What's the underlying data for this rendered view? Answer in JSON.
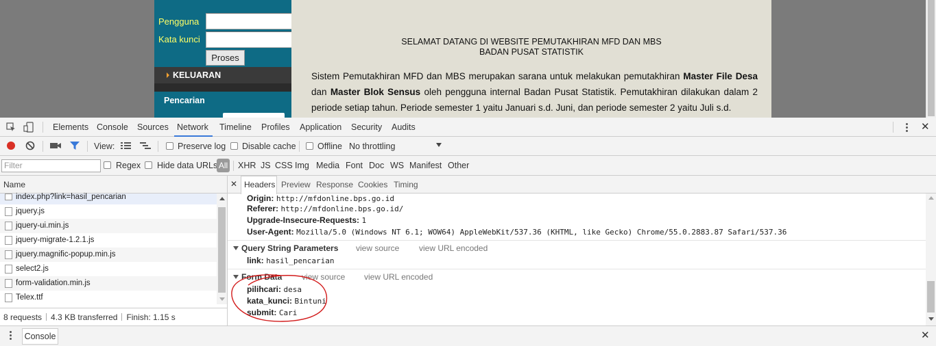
{
  "webpage": {
    "login": {
      "user_label": "Pengguna",
      "password_label": "Kata kunci",
      "submit_label": "Proses"
    },
    "menu": {
      "keluaran": "KELUARAN",
      "pencarian": "Pencarian"
    },
    "welcome": {
      "line1": "SELAMAT DATANG DI WEBSITE PEMUTAKHIRAN MFD DAN MBS",
      "line2": "BADAN PUSAT STATISTIK"
    },
    "intro": {
      "t1": "Sistem Pemutakhiran MFD dan MBS merupakan sarana untuk melakukan pemutakhiran ",
      "b1": "Master File Desa",
      "t2": " dan ",
      "b2": "Master Blok Sensus",
      "t3": " oleh pengguna internal Badan Pusat Statistik. Pemutakhiran dilakukan dalam 2 periode setiap tahun. Periode semester 1 yaitu Januari s.d. Juni, dan periode semester 2 yaitu Juli s.d."
    }
  },
  "devtools": {
    "tabs": [
      "Elements",
      "Console",
      "Sources",
      "Network",
      "Timeline",
      "Profiles",
      "Application",
      "Security",
      "Audits"
    ],
    "active_tab": "Network",
    "toolbar": {
      "view_label": "View:",
      "preserve_log": "Preserve log",
      "disable_cache": "Disable cache",
      "offline": "Offline",
      "throttling": "No throttling"
    },
    "filterbar": {
      "filter_placeholder": "Filter",
      "regex": "Regex",
      "hide_data_urls": "Hide data URLs",
      "types": [
        "All",
        "XHR",
        "JS",
        "CSS",
        "Img",
        "Media",
        "Font",
        "Doc",
        "WS",
        "Manifest",
        "Other"
      ]
    },
    "requests": {
      "column_name": "Name",
      "items": [
        "index.php?link=hasil_pencarian",
        "jquery.js",
        "jquery-ui.min.js",
        "jquery-migrate-1.2.1.js",
        "jquery.magnific-popup.min.js",
        "select2.js",
        "form-validation.min.js",
        "Telex.ttf"
      ],
      "status": {
        "requests": "8 requests",
        "transferred": "4.3 KB transferred",
        "finish": "Finish: 1.15 s"
      }
    },
    "detail": {
      "tabs": [
        "Headers",
        "Preview",
        "Response",
        "Cookies",
        "Timing"
      ],
      "request_headers": [
        {
          "key": "Origin:",
          "value": "http://mfdonline.bps.go.id"
        },
        {
          "key": "Referer:",
          "value": "http://mfdonline.bps.go.id/"
        },
        {
          "key": "Upgrade-Insecure-Requests:",
          "value": "1"
        },
        {
          "key": "User-Agent:",
          "value": "Mozilla/5.0 (Windows NT 6.1; WOW64) AppleWebKit/537.36 (KHTML, like Gecko) Chrome/55.0.2883.87 Safari/537.36"
        }
      ],
      "query_section": {
        "title": "Query String Parameters",
        "view_source": "view source",
        "view_url_encoded": "view URL encoded",
        "params": [
          {
            "key": "link:",
            "value": "hasil_pencarian"
          }
        ]
      },
      "form_section": {
        "title": "Form Data",
        "view_source": "view source",
        "view_url_encoded": "view URL encoded",
        "params": [
          {
            "key": "pilihcari:",
            "value": "desa"
          },
          {
            "key": "kata_kunci:",
            "value": "Bintuni"
          },
          {
            "key": "submit:",
            "value": "Cari"
          }
        ]
      }
    },
    "drawer": {
      "console_tab": "Console"
    },
    "colors": {
      "record_red": "#d93025",
      "accent_blue": "#3879d9",
      "annotation_red": "#d21a1a"
    }
  }
}
